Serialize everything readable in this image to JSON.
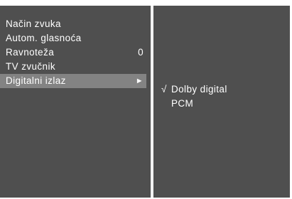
{
  "menu": {
    "items": [
      {
        "label": "Način zvuka"
      },
      {
        "label": "Autom. glasnoća"
      },
      {
        "label": "Ravnoteža",
        "value": "0"
      },
      {
        "label": "TV zvučnik"
      },
      {
        "label": "Digitalni izlaz",
        "arrow": "►",
        "selected": true
      }
    ]
  },
  "submenu": {
    "items": [
      {
        "label": "Dolby digital",
        "check": "√",
        "checked": true
      },
      {
        "label": "PCM",
        "checked": false
      }
    ]
  },
  "colors": {
    "panel": "#4f4f4f",
    "highlight": "#838383",
    "divider": "#f2f2f2",
    "text": "#ffffff"
  }
}
